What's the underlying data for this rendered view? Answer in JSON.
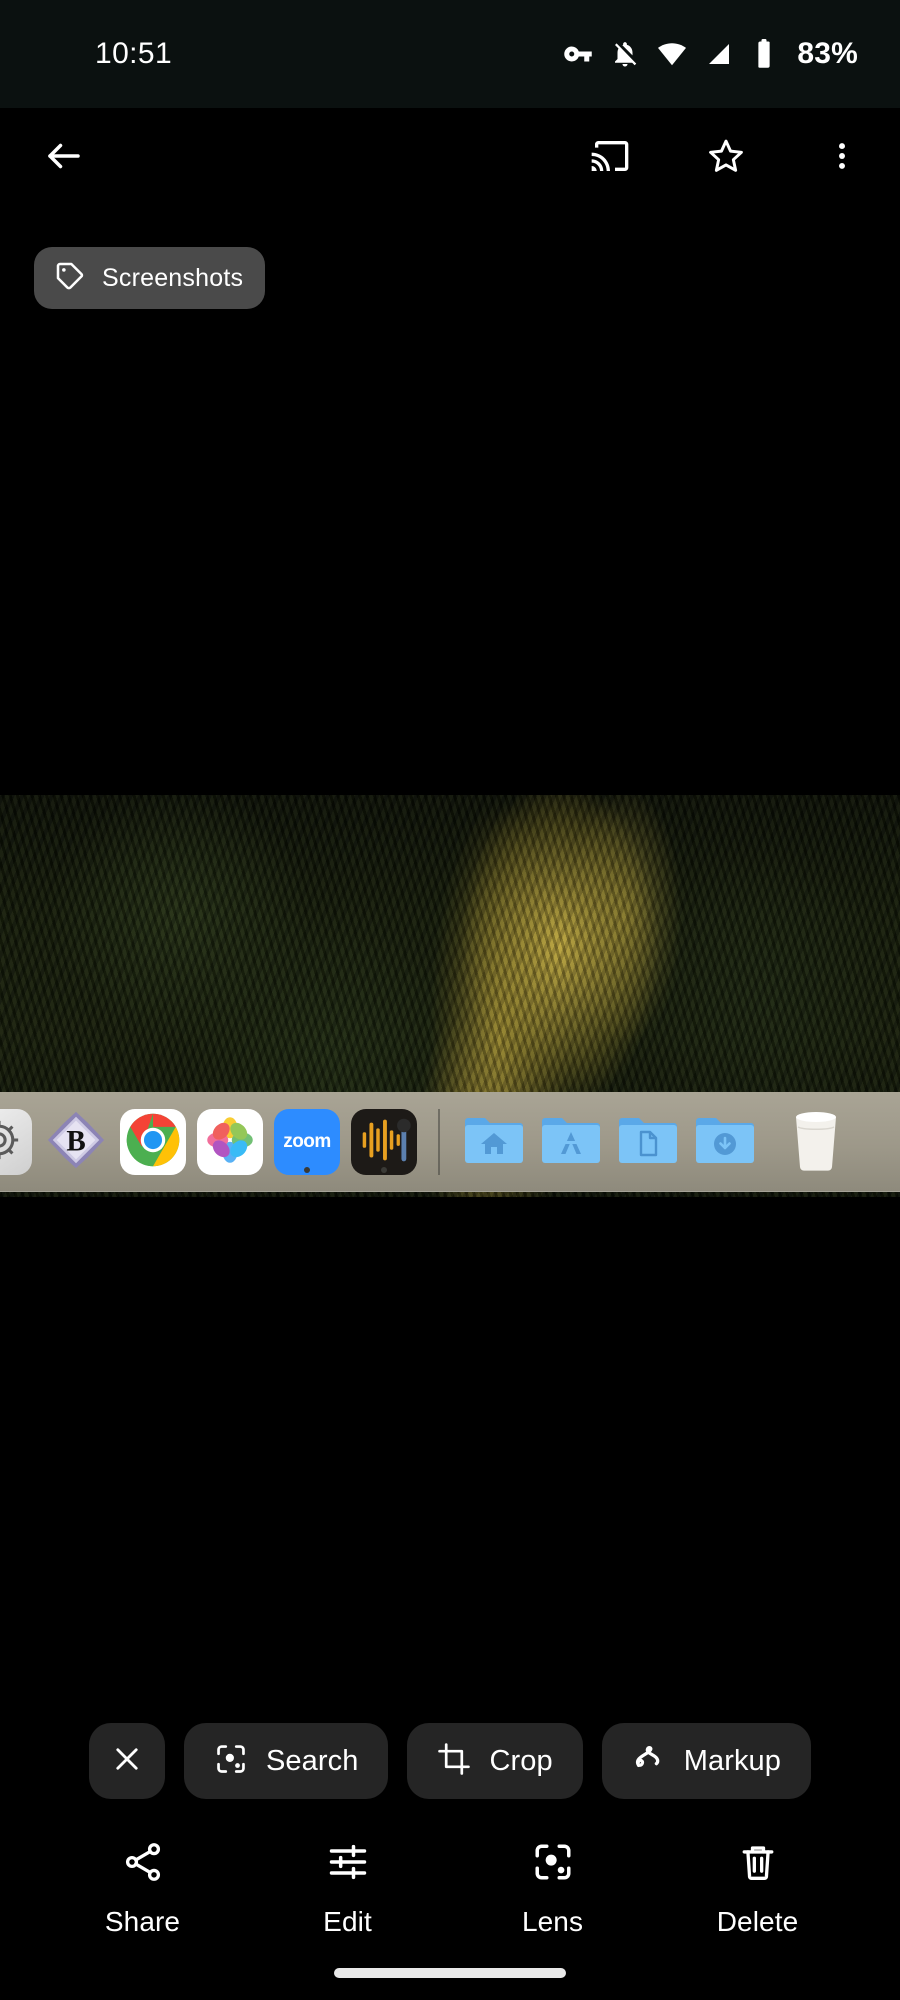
{
  "status_bar": {
    "time": "10:51",
    "battery_percent": "83%",
    "icons": [
      "vpn-key-icon",
      "notifications-muted-icon",
      "wifi-icon",
      "cellular-signal-icon",
      "battery-icon"
    ]
  },
  "app_bar": {
    "back": "back-arrow-icon",
    "cast": "cast-icon",
    "favorite": "star-outline-icon",
    "overflow": "more-vert-icon"
  },
  "album_chip": {
    "label": "Screenshots",
    "icon": "tag-icon"
  },
  "photo": {
    "description": "Screenshot of a macOS desktop showing a dark forest wallpaper with a yellow autumn tree and the Dock at the bottom",
    "dock": {
      "apps": [
        {
          "name": "System Settings",
          "icon": "settings-gear-icon",
          "label": "",
          "running": false
        },
        {
          "name": "Bible",
          "icon": "b-badge-icon",
          "label": "B",
          "running": false
        },
        {
          "name": "Google Chrome",
          "icon": "chrome-icon",
          "label": "",
          "running": false
        },
        {
          "name": "Photos",
          "icon": "photos-icon",
          "label": "",
          "running": false
        },
        {
          "name": "Zoom",
          "icon": "zoom-icon",
          "label": "zoom",
          "running": true
        },
        {
          "name": "Audio Recorder",
          "icon": "audio-waveform-icon",
          "label": "",
          "running": true
        }
      ],
      "folders": [
        {
          "name": "Home",
          "icon": "home-folder-icon"
        },
        {
          "name": "Applications",
          "icon": "applications-folder-icon"
        },
        {
          "name": "Documents",
          "icon": "documents-folder-icon"
        },
        {
          "name": "Downloads",
          "icon": "downloads-folder-icon"
        }
      ],
      "trash": {
        "name": "Trash",
        "icon": "trash-bin-icon"
      }
    }
  },
  "suggestion_chips": [
    {
      "label": "",
      "icon": "close-icon",
      "name": "close-suggestions"
    },
    {
      "label": "Search",
      "icon": "lens-search-icon",
      "name": "search"
    },
    {
      "label": "Crop",
      "icon": "crop-icon",
      "name": "crop"
    },
    {
      "label": "Markup",
      "icon": "markup-squiggle-icon",
      "name": "markup"
    }
  ],
  "bottom_nav": [
    {
      "label": "Share",
      "icon": "share-icon"
    },
    {
      "label": "Edit",
      "icon": "tune-sliders-icon"
    },
    {
      "label": "Lens",
      "icon": "google-lens-icon"
    },
    {
      "label": "Delete",
      "icon": "trash-icon"
    }
  ],
  "colors": {
    "background": "#000000",
    "status_bar_bg": "#0b1110",
    "chip_bg": "#252525",
    "album_chip_bg": "#4a4a4a",
    "text": "#ffffff",
    "dock_bg": "#9d9889",
    "zoom_blue": "#2d8cff"
  }
}
